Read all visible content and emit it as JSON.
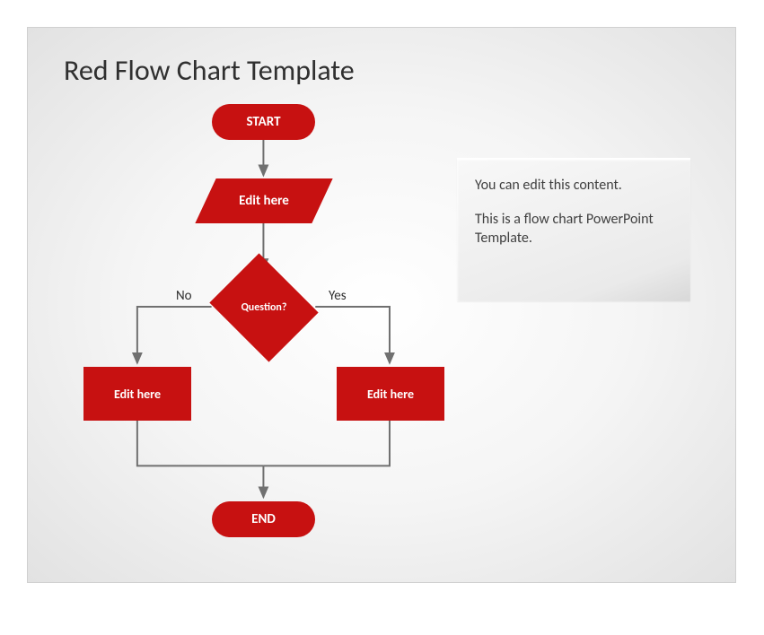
{
  "title": "Red Flow Chart Template",
  "nodes": {
    "start": "START",
    "input": "Edit here",
    "question": "Question?",
    "left_process": "Edit here",
    "right_process": "Edit here",
    "end": "END"
  },
  "branch_labels": {
    "no": "No",
    "yes": "Yes"
  },
  "textbox": {
    "line1": "You can edit this content.",
    "line2": "This is a flow chart PowerPoint Template."
  },
  "colors": {
    "shape_fill": "#c71111",
    "connector": "#707070"
  }
}
